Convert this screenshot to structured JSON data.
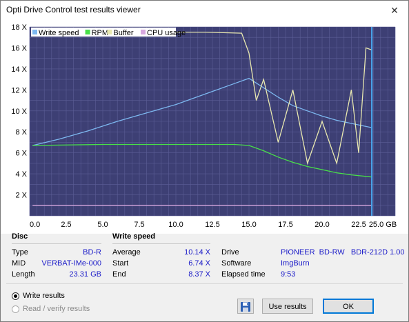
{
  "window": {
    "title": "Opti Drive Control test results viewer",
    "close_glyph": "✕"
  },
  "chart_data": {
    "type": "line",
    "xlabel_unit": "GB",
    "x_ticks": [
      "0.0",
      "2.5",
      "5.0",
      "7.5",
      "10.0",
      "12.5",
      "15.0",
      "17.5",
      "20.0",
      "22.5",
      "25.0 GB"
    ],
    "y_ticks": [
      "2 X",
      "4 X",
      "6 X",
      "8 X",
      "10 X",
      "12 X",
      "14 X",
      "16 X",
      "18 X"
    ],
    "xlim": [
      0,
      25
    ],
    "ylim": [
      0,
      18
    ],
    "legend": [
      {
        "name": "Write speed",
        "color": "#7db8f0"
      },
      {
        "name": "RPM",
        "color": "#48e048"
      },
      {
        "name": "Buffer",
        "color": "#e8e8b0"
      },
      {
        "name": "CPU usage",
        "color": "#d8a8e0"
      }
    ],
    "series": [
      {
        "name": "Write speed",
        "color": "#7db8f0",
        "x": [
          0.2,
          2,
          4,
          6,
          8,
          10,
          12,
          14,
          15,
          16,
          17,
          18,
          19,
          20,
          21,
          22,
          23.4
        ],
        "y": [
          6.7,
          7.3,
          8.1,
          9.0,
          9.8,
          10.6,
          11.6,
          12.6,
          13.1,
          12.2,
          11.3,
          10.5,
          10.0,
          9.5,
          9.1,
          8.8,
          8.4
        ]
      },
      {
        "name": "RPM",
        "color": "#48e048",
        "x": [
          0.2,
          5,
          10,
          14,
          15,
          16,
          17,
          18,
          19,
          20,
          21,
          22,
          23.4
        ],
        "y": [
          6.7,
          6.8,
          6.8,
          6.8,
          6.7,
          6.2,
          5.6,
          5.1,
          4.7,
          4.4,
          4.1,
          3.9,
          3.7
        ]
      },
      {
        "name": "Buffer",
        "color": "#e8e8b0",
        "x": [
          0.2,
          5,
          10,
          12,
          14.5,
          15,
          15.5,
          16,
          17,
          18,
          19,
          20,
          21,
          22,
          22.5,
          23,
          23.4
        ],
        "y": [
          17.5,
          17.5,
          17.5,
          17.5,
          17.4,
          15.5,
          11,
          13,
          7,
          12,
          5,
          9,
          5,
          12,
          6,
          16,
          15.8
        ]
      },
      {
        "name": "CPU usage",
        "color": "#d8a8e0",
        "x": [
          0.2,
          2,
          4,
          6,
          8,
          10,
          12,
          14,
          16,
          18,
          20,
          22,
          23.4
        ],
        "y": [
          1.0,
          1.0,
          1.0,
          1.0,
          1.0,
          1.0,
          1.0,
          1.0,
          1.0,
          1.0,
          1.0,
          1.0,
          1.0
        ]
      }
    ]
  },
  "disc": {
    "heading": "Disc",
    "type_label": "Type",
    "type_value": "BD-R",
    "mid_label": "MID",
    "mid_value": "VERBAT-IMe-000",
    "length_label": "Length",
    "length_value": "23.31 GB"
  },
  "write_speed": {
    "heading": "Write speed",
    "average_label": "Average",
    "average_value": "10.14 X",
    "start_label": "Start",
    "start_value": "6.74 X",
    "end_label": "End",
    "end_value": "8.37 X"
  },
  "info": {
    "drive_label": "Drive",
    "drive_value": "PIONEER  BD-RW   BDR-212D 1.00",
    "software_label": "Software",
    "software_value": "ImgBurn",
    "elapsed_label": "Elapsed time",
    "elapsed_value": "9:53"
  },
  "options": {
    "write_results": "Write results",
    "read_verify_results": "Read / verify results"
  },
  "buttons": {
    "use_results": "Use results",
    "ok": "OK",
    "save_icon": "save-disk"
  }
}
